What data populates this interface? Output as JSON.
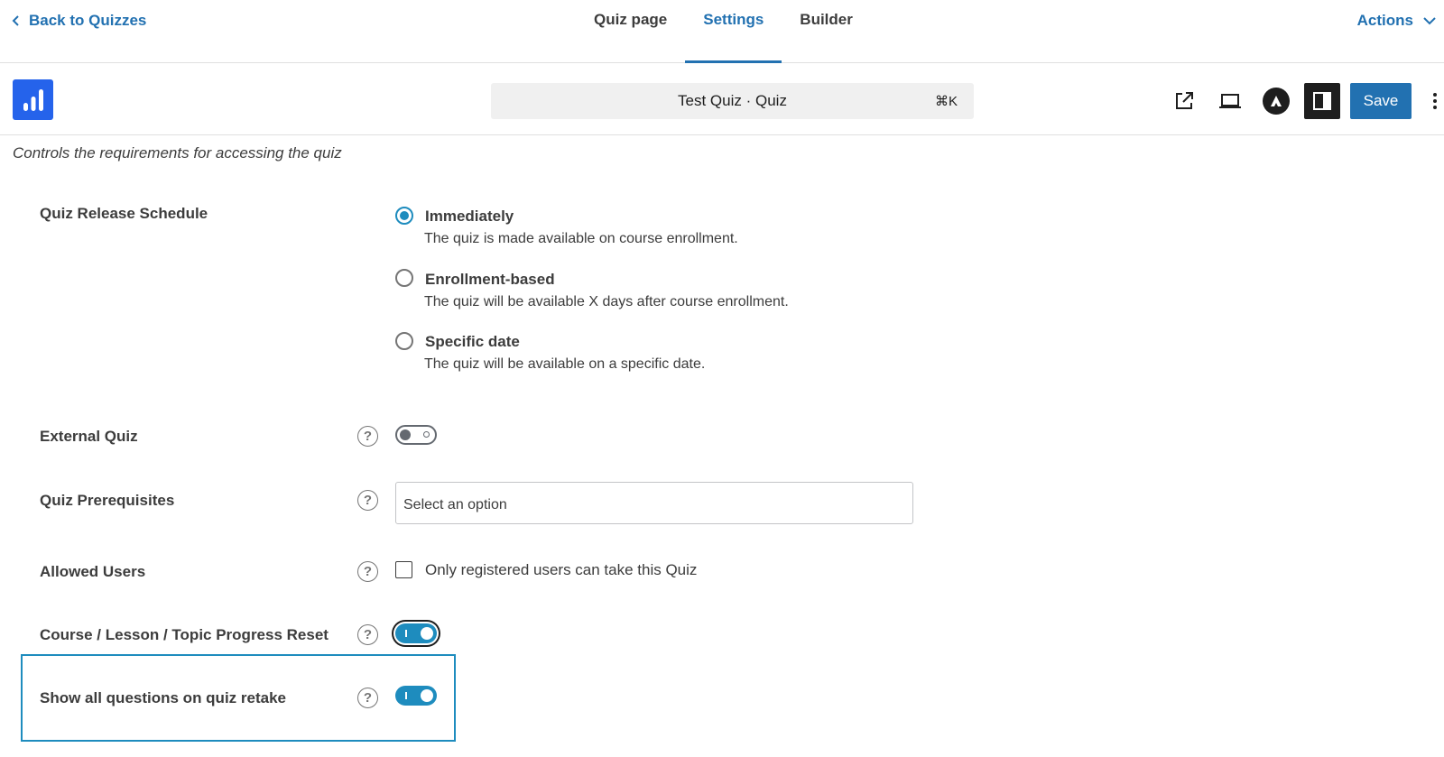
{
  "topnav": {
    "back_label": "Back to Quizzes",
    "tabs": [
      {
        "label": "Quiz page",
        "active": false
      },
      {
        "label": "Settings",
        "active": true
      },
      {
        "label": "Builder",
        "active": false
      }
    ],
    "actions_label": "Actions"
  },
  "editor": {
    "command_title": "Test Quiz · Quiz",
    "command_shortcut": "⌘K",
    "save_label": "Save"
  },
  "section": {
    "description": "Controls the requirements for accessing the quiz"
  },
  "release_schedule": {
    "label": "Quiz Release Schedule",
    "options": [
      {
        "title": "Immediately",
        "description": "The quiz is made available on course enrollment.",
        "checked": true
      },
      {
        "title": "Enrollment-based",
        "description": "The quiz will be available X days after course enrollment.",
        "checked": false
      },
      {
        "title": "Specific date",
        "description": "The quiz will be available on a specific date.",
        "checked": false
      }
    ]
  },
  "external_quiz": {
    "label": "External Quiz",
    "enabled": false
  },
  "prerequisites": {
    "label": "Quiz Prerequisites",
    "placeholder": "Select an option"
  },
  "allowed_users": {
    "label": "Allowed Users",
    "checkbox_label": "Only registered users can take this Quiz",
    "checked": false
  },
  "progress_reset": {
    "label": "Course / Lesson / Topic Progress Reset",
    "enabled": true
  },
  "show_all_questions": {
    "label": "Show all questions on quiz retake",
    "enabled": true
  },
  "help_glyph": "?",
  "colors": {
    "accent": "#2271b1",
    "toggle_on": "#1e8cbe",
    "logo": "#2563eb"
  }
}
